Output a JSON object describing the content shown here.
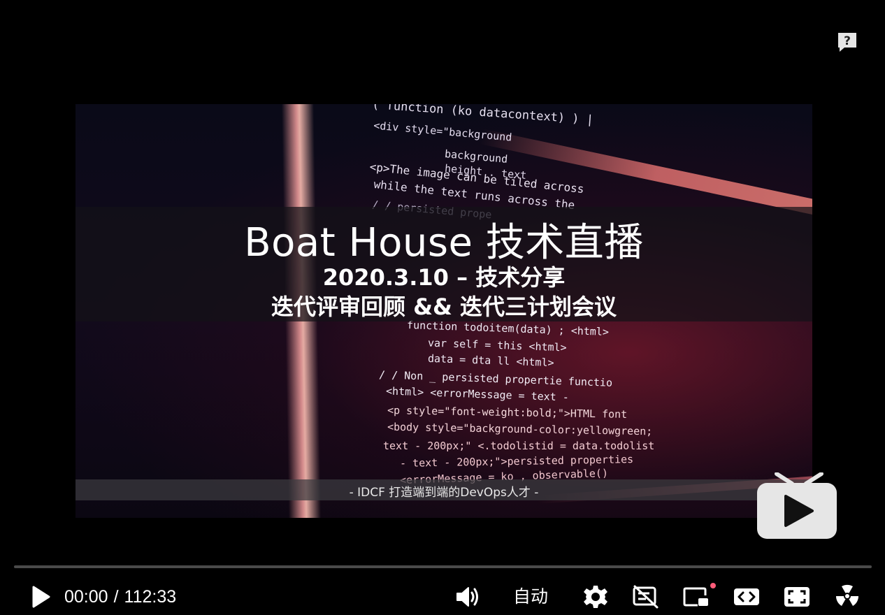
{
  "video": {
    "title_main": "Boat House 技术直播",
    "title_sub1": "2020.3.10 – 技术分享",
    "title_sub2": "迭代评审回顾 && 迭代三计划会议",
    "footer_caption": "- IDCF 打造端到端的DevOps人才 -",
    "code_snippets": [
      "( function  (ko  datacontext) ) |",
      "<div style=\"background",
      "background",
      "height . text",
      "<p>The image can be tiled across",
      "while the text runs across the",
      "/ /  persisted prope",
      "function   todoitem(data) ;  <html>",
      "var   self = this <html>",
      "data = dta   ll   <html>",
      "/ / Non _ persisted propertie  functio",
      "<html>  <errorMessage = text -",
      "<p style=\"font-weight:bold;\">HTML font",
      "<body style=\"background-color:yellowgreen;",
      "text - 200px;\"  <.todolistid = data.todolist",
      "- text - 200px;\">persisted properties",
      "<errorMessage = ko , observable()"
    ]
  },
  "player": {
    "current_time": "00:00",
    "separator": "/",
    "duration": "112:33",
    "progress": 0.0,
    "quality_label": "自动",
    "icons": {
      "help": "help-question-icon",
      "play": "play-icon",
      "volume": "volume-icon",
      "settings": "gear-icon",
      "danmaku_off": "danmaku-off-icon",
      "pip": "picture-in-picture-icon",
      "widescreen": "widescreen-icon",
      "fullscreen": "fullscreen-icon",
      "radiation": "radiation-icon",
      "big_play": "bilibili-tv-play-icon"
    },
    "colors": {
      "background": "#000000",
      "progress_track": "#4a4a4a",
      "notify_dot": "#ff5c7a",
      "big_play_fill": "#e6e6e6"
    }
  }
}
